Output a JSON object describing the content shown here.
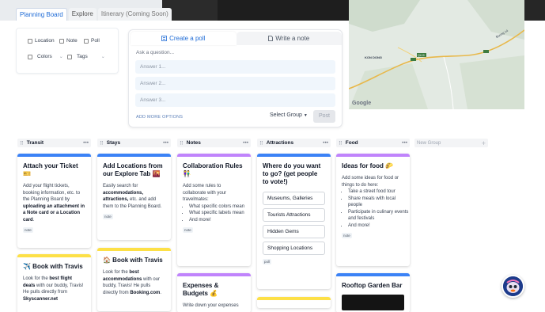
{
  "nav": {
    "tabs": [
      "Planning Board",
      "Explore",
      "Itinerary (Coming Soon)"
    ]
  },
  "filters": {
    "location": "Location",
    "note": "Note",
    "poll": "Poll",
    "colors": "Colors",
    "tags": "Tags"
  },
  "poll": {
    "create_tab": "Create a poll",
    "write_tab": "Write a note",
    "question_placeholder": "Ask a question...",
    "answers": [
      "Answer 1...",
      "Answer 2...",
      "Answer 3..."
    ],
    "add_more": "ADD MORE OPTIONS",
    "select_group": "Select Group",
    "post": "Post"
  },
  "map": {
    "labels": [
      "KON DONG",
      "Buong 14",
      "Google"
    ]
  },
  "board": {
    "columns": [
      {
        "name": "Transit",
        "cards": [
          {
            "title": "Attach your Ticket 🎫",
            "body_pre": "Add your flight tickets, booking information, etc. to the Planning Board by ",
            "body_bold": "uploading an attachment in a Note card or a Location card",
            "body_post": ".",
            "tag": "note"
          },
          {
            "title": "✈️ Book with Travis",
            "body_pre": "Look for the ",
            "body_bold": "best flight deals",
            "body_post": " with our buddy, Travis! He pulls directly from",
            "body_cut": "Skyscanner.net"
          }
        ]
      },
      {
        "name": "Stays",
        "cards": [
          {
            "title": "Add Locations from our Explore Tab 🌇",
            "body_pre": "Easily search for ",
            "body_bold": "accommodations, attractions,",
            "body_post": " etc. and add them to the Planning Board.",
            "tag": "note"
          },
          {
            "title": "🏠 Book with Travis",
            "body_pre": "Look for the ",
            "body_bold": "best accommodations",
            "body_post": " with our buddy, Travis! He pulls directly from ",
            "body_bold2": "Booking.com",
            "body_end": "."
          }
        ]
      },
      {
        "name": "Notes",
        "cards": [
          {
            "title": "Collaboration Rules 👫",
            "body": "Add some rules to collaborate with your travelmates:",
            "items": [
              "What specific colors mean",
              "What specific labels mean",
              "And more!"
            ],
            "tag": "note"
          },
          {
            "title": "Expenses & Budgets 💰",
            "body": "Write down your expenses"
          }
        ]
      },
      {
        "name": "Attractions",
        "cards": [
          {
            "title": "Where do you want to go? (get people to vote!)",
            "options": [
              "Museums, Galleries",
              "Tourists Attractions",
              "Hidden Gems",
              "Shopping Locations"
            ],
            "tag": "poll"
          }
        ]
      },
      {
        "name": "Food",
        "cards": [
          {
            "title": "Ideas for food 🌮",
            "body": "Add some ideas for food or things to do here:",
            "items": [
              "Take a street food tour",
              "Share meals with local people",
              "Participate in culinary events and festivals",
              "And more!"
            ],
            "tag": "note"
          },
          {
            "title": "Rooftop Garden Bar"
          }
        ]
      }
    ],
    "new_group": "New Group"
  },
  "colors": {
    "accent": "#1e6bd6",
    "blue_bar": "#3b82f6",
    "yellow_bar": "#fde047",
    "purple_bar": "#c084fc"
  }
}
